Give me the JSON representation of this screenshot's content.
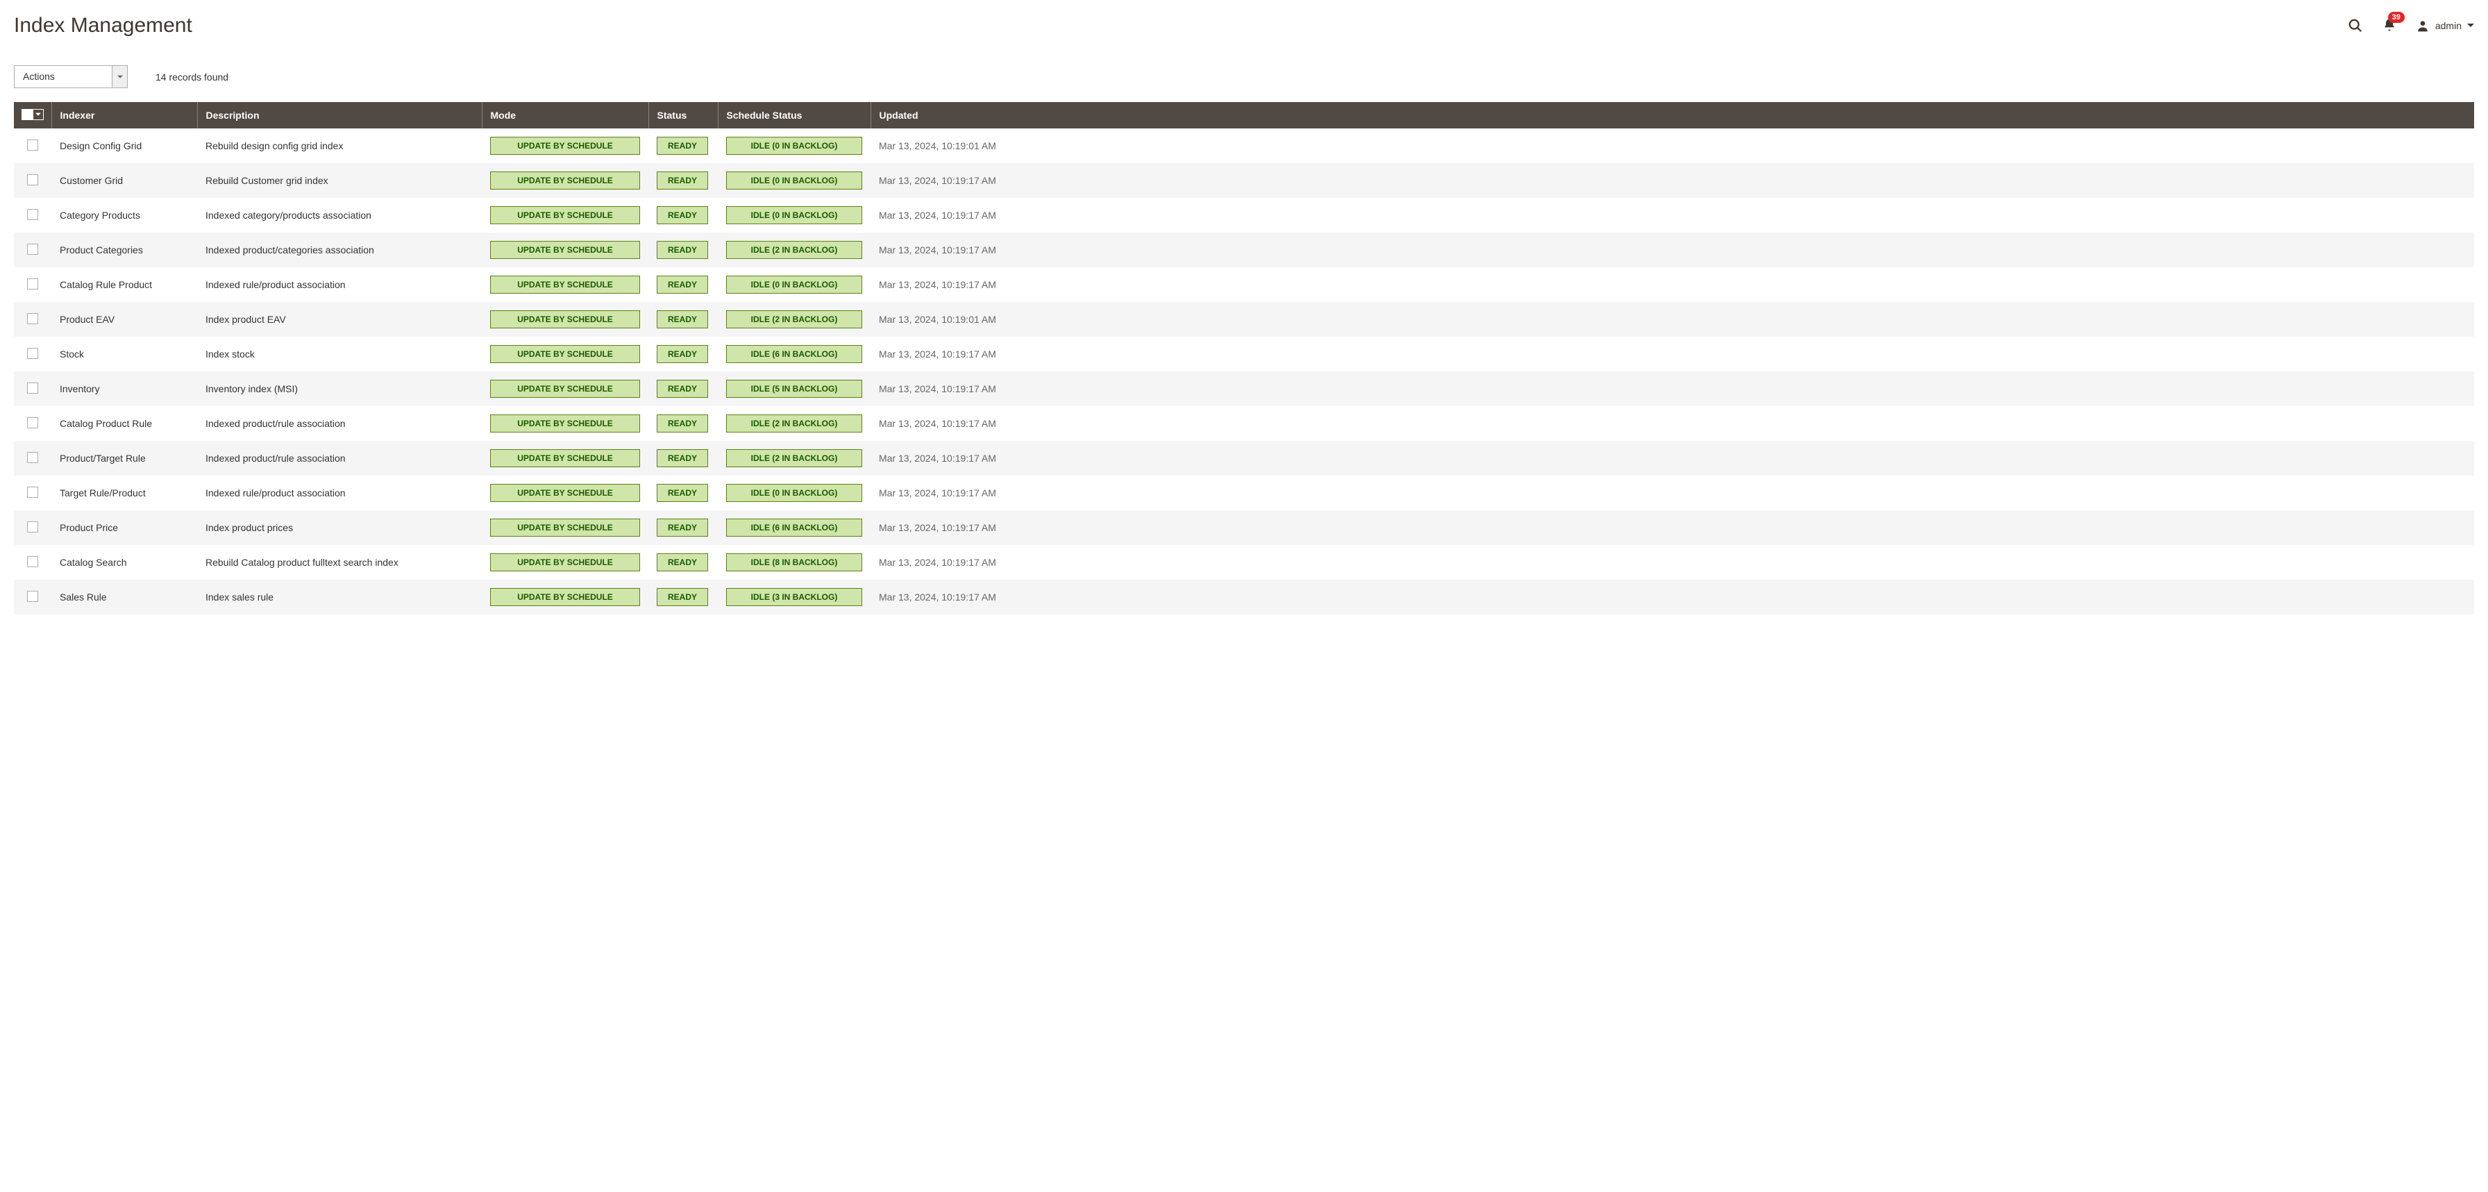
{
  "header": {
    "title": "Index Management",
    "notif_count": "39",
    "user_name": "admin"
  },
  "toolbar": {
    "actions_label": "Actions",
    "records_found": "14 records found"
  },
  "table": {
    "headers": {
      "indexer": "Indexer",
      "description": "Description",
      "mode": "Mode",
      "status": "Status",
      "schedule": "Schedule Status",
      "updated": "Updated"
    },
    "rows": [
      {
        "indexer": "Design Config Grid",
        "description": "Rebuild design config grid index",
        "mode": "UPDATE BY SCHEDULE",
        "status": "READY",
        "schedule": "IDLE (0 IN BACKLOG)",
        "updated": "Mar 13, 2024, 10:19:01 AM"
      },
      {
        "indexer": "Customer Grid",
        "description": "Rebuild Customer grid index",
        "mode": "UPDATE BY SCHEDULE",
        "status": "READY",
        "schedule": "IDLE (0 IN BACKLOG)",
        "updated": "Mar 13, 2024, 10:19:17 AM"
      },
      {
        "indexer": "Category Products",
        "description": "Indexed category/products association",
        "mode": "UPDATE BY SCHEDULE",
        "status": "READY",
        "schedule": "IDLE (0 IN BACKLOG)",
        "updated": "Mar 13, 2024, 10:19:17 AM"
      },
      {
        "indexer": "Product Categories",
        "description": "Indexed product/categories association",
        "mode": "UPDATE BY SCHEDULE",
        "status": "READY",
        "schedule": "IDLE (2 IN BACKLOG)",
        "updated": "Mar 13, 2024, 10:19:17 AM"
      },
      {
        "indexer": "Catalog Rule Product",
        "description": "Indexed rule/product association",
        "mode": "UPDATE BY SCHEDULE",
        "status": "READY",
        "schedule": "IDLE (0 IN BACKLOG)",
        "updated": "Mar 13, 2024, 10:19:17 AM"
      },
      {
        "indexer": "Product EAV",
        "description": "Index product EAV",
        "mode": "UPDATE BY SCHEDULE",
        "status": "READY",
        "schedule": "IDLE (2 IN BACKLOG)",
        "updated": "Mar 13, 2024, 10:19:01 AM"
      },
      {
        "indexer": "Stock",
        "description": "Index stock",
        "mode": "UPDATE BY SCHEDULE",
        "status": "READY",
        "schedule": "IDLE (6 IN BACKLOG)",
        "updated": "Mar 13, 2024, 10:19:17 AM"
      },
      {
        "indexer": "Inventory",
        "description": "Inventory index (MSI)",
        "mode": "UPDATE BY SCHEDULE",
        "status": "READY",
        "schedule": "IDLE (5 IN BACKLOG)",
        "updated": "Mar 13, 2024, 10:19:17 AM"
      },
      {
        "indexer": "Catalog Product Rule",
        "description": "Indexed product/rule association",
        "mode": "UPDATE BY SCHEDULE",
        "status": "READY",
        "schedule": "IDLE (2 IN BACKLOG)",
        "updated": "Mar 13, 2024, 10:19:17 AM"
      },
      {
        "indexer": "Product/Target Rule",
        "description": "Indexed product/rule association",
        "mode": "UPDATE BY SCHEDULE",
        "status": "READY",
        "schedule": "IDLE (2 IN BACKLOG)",
        "updated": "Mar 13, 2024, 10:19:17 AM"
      },
      {
        "indexer": "Target Rule/Product",
        "description": "Indexed rule/product association",
        "mode": "UPDATE BY SCHEDULE",
        "status": "READY",
        "schedule": "IDLE (0 IN BACKLOG)",
        "updated": "Mar 13, 2024, 10:19:17 AM"
      },
      {
        "indexer": "Product Price",
        "description": "Index product prices",
        "mode": "UPDATE BY SCHEDULE",
        "status": "READY",
        "schedule": "IDLE (6 IN BACKLOG)",
        "updated": "Mar 13, 2024, 10:19:17 AM"
      },
      {
        "indexer": "Catalog Search",
        "description": "Rebuild Catalog product fulltext search index",
        "mode": "UPDATE BY SCHEDULE",
        "status": "READY",
        "schedule": "IDLE (8 IN BACKLOG)",
        "updated": "Mar 13, 2024, 10:19:17 AM"
      },
      {
        "indexer": "Sales Rule",
        "description": "Index sales rule",
        "mode": "UPDATE BY SCHEDULE",
        "status": "READY",
        "schedule": "IDLE (3 IN BACKLOG)",
        "updated": "Mar 13, 2024, 10:19:17 AM"
      }
    ]
  }
}
